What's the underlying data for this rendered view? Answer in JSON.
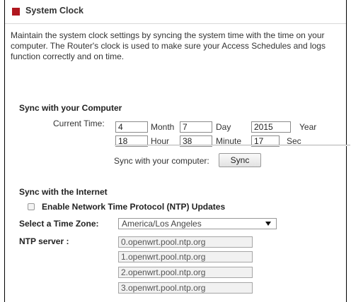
{
  "header": {
    "title": "System Clock"
  },
  "description": "Maintain the system clock settings by syncing the system time with the time on your computer. The Router's clock is used to make sure your Access Schedules and logs function correctly and on time.",
  "computer_sync": {
    "heading": "Sync with your Computer",
    "current_time_label": "Current Time:",
    "month_value": "4",
    "month_label": "Month",
    "day_value": "7",
    "day_label": "Day",
    "year_value": "2015",
    "year_label": "Year",
    "hour_value": "18",
    "hour_label": "Hour",
    "minute_value": "38",
    "minute_label": "Minute",
    "sec_value": "17",
    "sec_label": "Sec",
    "sync_label": "Sync with your computer:",
    "sync_button": "Sync"
  },
  "internet_sync": {
    "heading": "Sync with the Internet",
    "ntp_checkbox_label": "Enable Network Time Protocol (NTP) Updates",
    "ntp_enabled": false,
    "timezone_label": "Select a Time Zone:",
    "timezone_value": "America/Los Angeles",
    "ntp_server_label": "NTP server :",
    "ntp_servers": [
      "0.openwrt.pool.ntp.org",
      "1.openwrt.pool.ntp.org",
      "2.openwrt.pool.ntp.org",
      "3.openwrt.pool.ntp.org"
    ]
  }
}
